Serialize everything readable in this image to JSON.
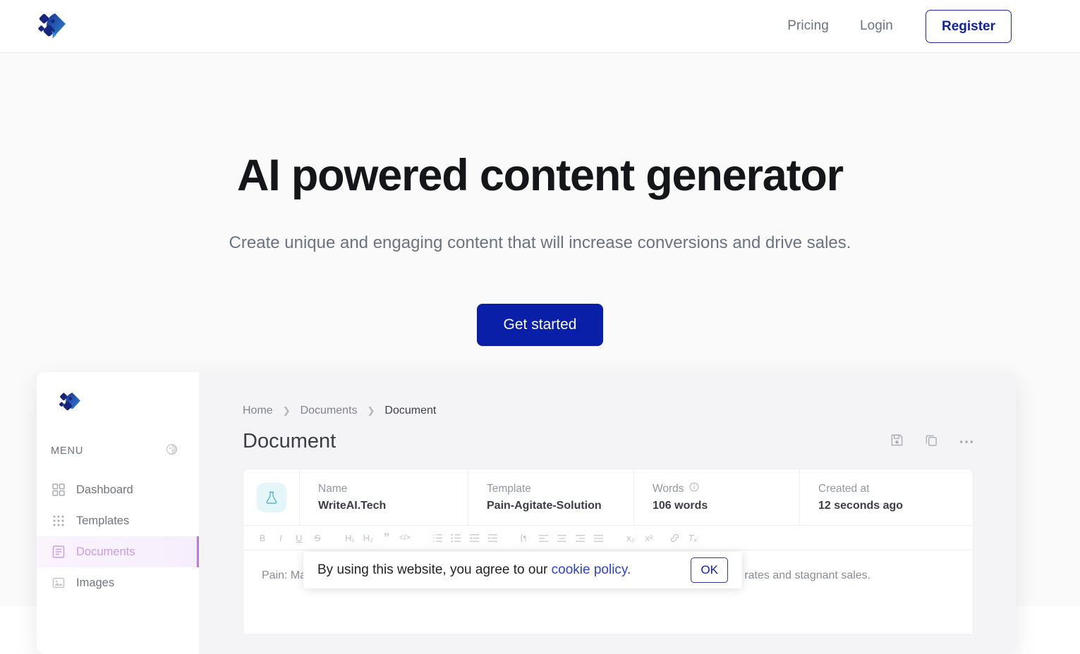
{
  "header": {
    "logo_icon": "writeai-logo-icon",
    "nav": [
      {
        "label": "Pricing",
        "name": "nav-pricing"
      },
      {
        "label": "Login",
        "name": "nav-login"
      }
    ],
    "register_label": "Register"
  },
  "hero": {
    "heading": "AI powered content generator",
    "subheading": "Create unique and engaging content that will increase conversions and drive sales.",
    "cta_label": "Get started"
  },
  "app_preview": {
    "sidebar": {
      "menu_label": "MENU",
      "theme_icon": "face-emoji-icon",
      "items": [
        {
          "label": "Dashboard",
          "icon": "grid-2x2-icon",
          "active": false
        },
        {
          "label": "Templates",
          "icon": "grid-3x3-dots-icon",
          "active": false
        },
        {
          "label": "Documents",
          "icon": "document-lines-icon",
          "active": true
        },
        {
          "label": "Images",
          "icon": "image-icon",
          "active": false
        }
      ]
    },
    "breadcrumb": [
      "Home",
      "Documents",
      "Document"
    ],
    "title": "Document",
    "actions": [
      {
        "name": "save-icon",
        "label": "save"
      },
      {
        "name": "copy-icon",
        "label": "copy"
      },
      {
        "name": "more-options-icon",
        "label": "more"
      }
    ],
    "info": {
      "flask_icon": "flask-icon",
      "fields": [
        {
          "key": "Name",
          "value": "WriteAI.Tech",
          "info_icon": false
        },
        {
          "key": "Template",
          "value": "Pain-Agitate-Solution",
          "info_icon": false
        },
        {
          "key": "Words",
          "value": "106 words",
          "info_icon": true
        },
        {
          "key": "Created at",
          "value": "12 seconds ago",
          "info_icon": false
        }
      ]
    },
    "toolbar": {
      "group1": [
        {
          "glyph": "B",
          "name": "bold-icon"
        },
        {
          "glyph": "I",
          "name": "italic-icon"
        },
        {
          "glyph": "U",
          "name": "underline-icon"
        },
        {
          "glyph": "S",
          "name": "strikethrough-icon"
        }
      ],
      "group2": [
        {
          "glyph": "H₁",
          "name": "heading-1-icon"
        },
        {
          "glyph": "H₂",
          "name": "heading-2-icon"
        },
        {
          "glyph": "”",
          "name": "blockquote-icon"
        },
        {
          "glyph": "</>",
          "name": "code-block-icon"
        }
      ],
      "group3": [
        {
          "glyph": "☰",
          "name": "ordered-list-icon"
        },
        {
          "glyph": "☰",
          "name": "bullet-list-icon"
        },
        {
          "glyph": "☰",
          "name": "outdent-icon"
        },
        {
          "glyph": "☰",
          "name": "indent-icon"
        }
      ],
      "group4": [
        {
          "glyph": "¶",
          "name": "text-direction-icon"
        },
        {
          "glyph": "☰",
          "name": "align-left-icon"
        },
        {
          "glyph": "☰",
          "name": "align-center-icon"
        },
        {
          "glyph": "☰",
          "name": "align-right-icon"
        },
        {
          "glyph": "☰",
          "name": "align-justify-icon"
        }
      ],
      "group5": [
        {
          "glyph": "x₂",
          "name": "subscript-icon"
        },
        {
          "glyph": "x²",
          "name": "superscript-icon"
        },
        {
          "glyph": "⚭",
          "name": "link-icon"
        },
        {
          "glyph": "Tₓ",
          "name": "clear-format-icon"
        }
      ]
    },
    "document_body": "Pain: Many businesses struggle to capture their audience's attention, resulting in low conversion rates and stagnant sales."
  },
  "cookie_banner": {
    "text_before": "By using this website, you agree to our ",
    "link_label": "cookie policy.",
    "ok_label": "OK"
  },
  "colors": {
    "primary_blue": "#0a1fa8",
    "register_blue": "#12239e",
    "active_purple": "#b07de0",
    "hero_bg": "#fafafa",
    "muted_text": "#6b7280"
  }
}
